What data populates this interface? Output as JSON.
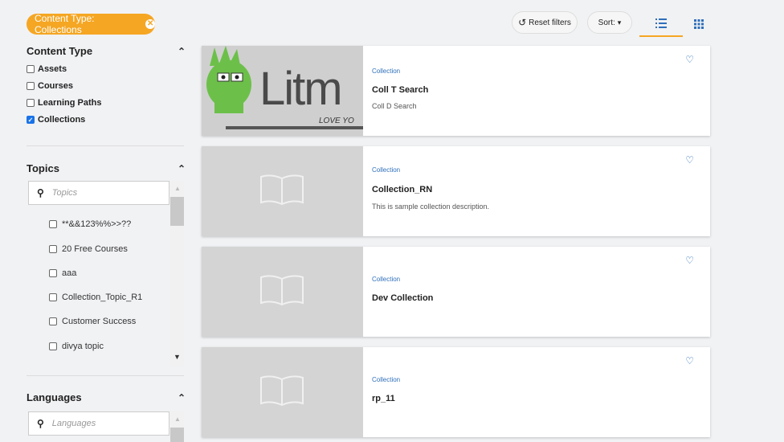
{
  "filter_chip": {
    "label": "Content Type: Collections"
  },
  "toolbar": {
    "reset_label": "Reset filters",
    "sort_label": "Sort:"
  },
  "content_type": {
    "heading": "Content Type",
    "items": [
      {
        "label": "Assets",
        "checked": false
      },
      {
        "label": "Courses",
        "checked": false
      },
      {
        "label": "Learning Paths",
        "checked": false
      },
      {
        "label": "Collections",
        "checked": true
      }
    ]
  },
  "topics": {
    "heading": "Topics",
    "search_placeholder": "Topics",
    "items": [
      {
        "label": "**&&123%%>>??"
      },
      {
        "label": "20 Free Courses"
      },
      {
        "label": "aaa"
      },
      {
        "label": "Collection_Topic_R1"
      },
      {
        "label": "Customer Success"
      },
      {
        "label": "divya topic"
      }
    ]
  },
  "languages": {
    "heading": "Languages",
    "search_placeholder": "Languages"
  },
  "cards": [
    {
      "type": "Collection",
      "title": "Coll T Search",
      "desc": "Coll D Search",
      "thumb_text": "Litm",
      "thumb_tag": "LOVE YO"
    },
    {
      "type": "Collection",
      "title": "Collection_RN",
      "desc": "This is sample collection description."
    },
    {
      "type": "Collection",
      "title": "Dev Collection",
      "desc": ""
    },
    {
      "type": "Collection",
      "title": "rp_11",
      "desc": ""
    }
  ],
  "colors": {
    "accent": "#f5a623",
    "link": "#2f6fba",
    "checkbox": "#1a73e8"
  }
}
